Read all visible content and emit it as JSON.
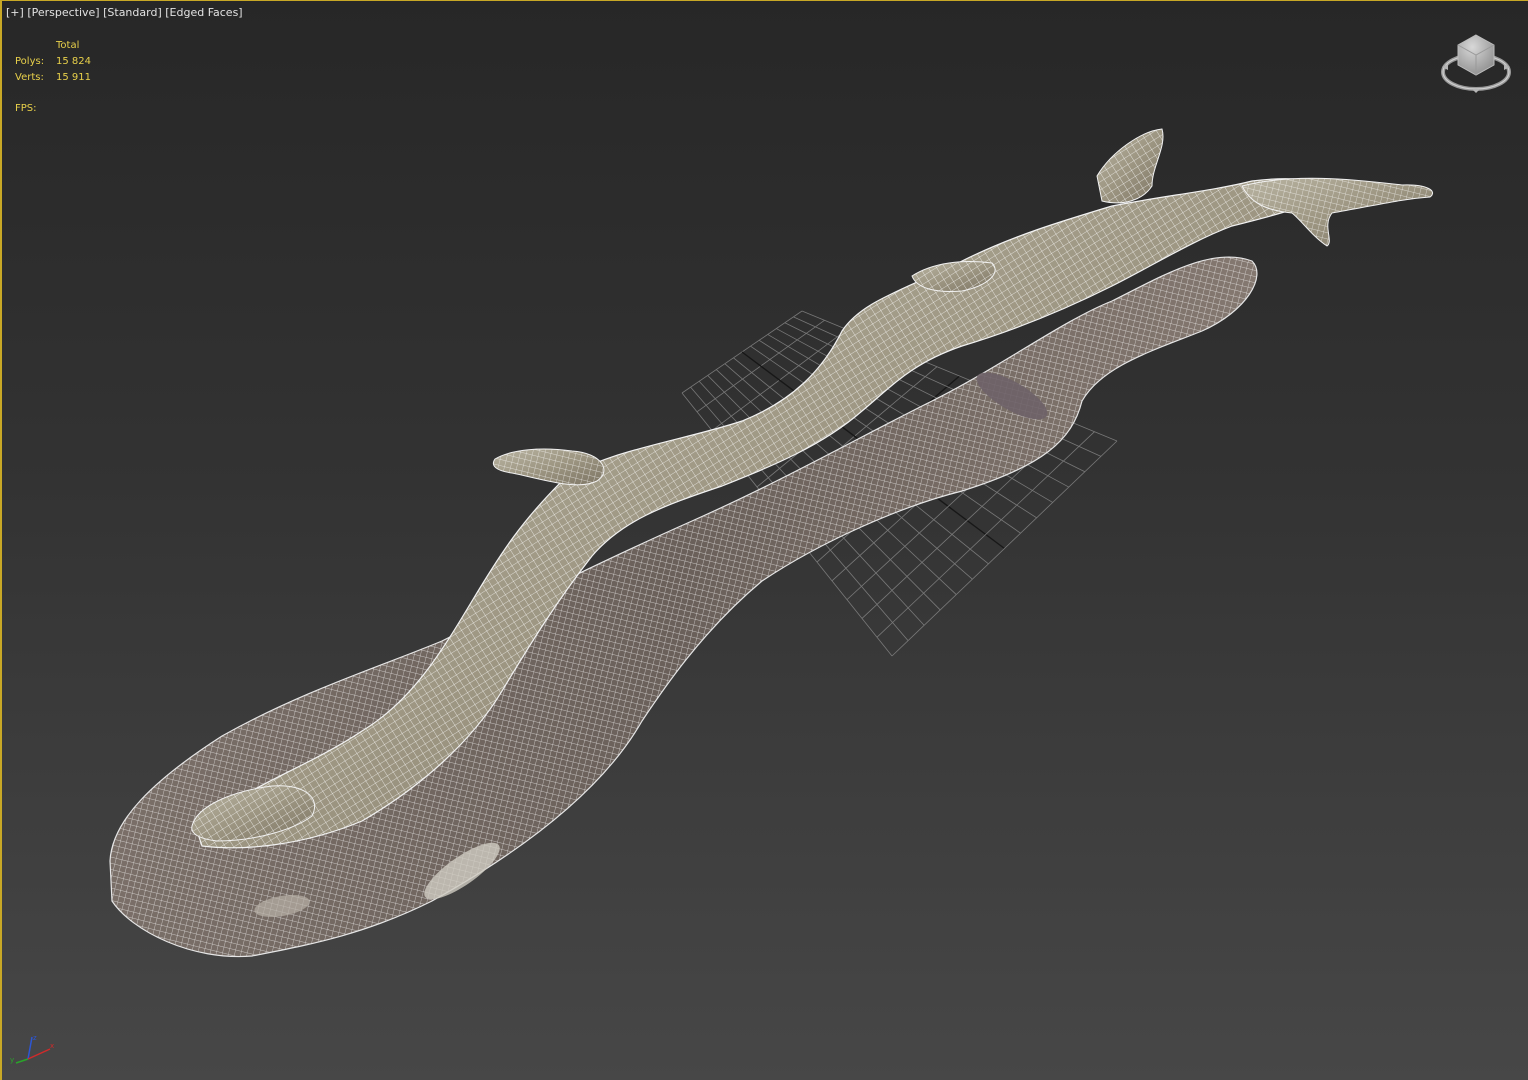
{
  "viewport": {
    "label_plus": "[+]",
    "label_view": "[Perspective]",
    "label_shading": "[Standard]",
    "label_mode": "[Edged Faces]"
  },
  "stats": {
    "header": "Total",
    "polys_label": "Polys:",
    "polys_value": "15 824",
    "verts_label": "Verts:",
    "verts_value": "15 911",
    "fps_label": "FPS:"
  },
  "viewcube": {
    "icon": "viewcube-icon"
  },
  "scene": {
    "object": "driftwood-log-wireframe-mesh",
    "grid": "home-grid"
  },
  "colors": {
    "viewport_border": "#c8a826",
    "stats_text": "#e8d04a",
    "label_text": "#e2e2e2",
    "wire": "#ffffff"
  }
}
